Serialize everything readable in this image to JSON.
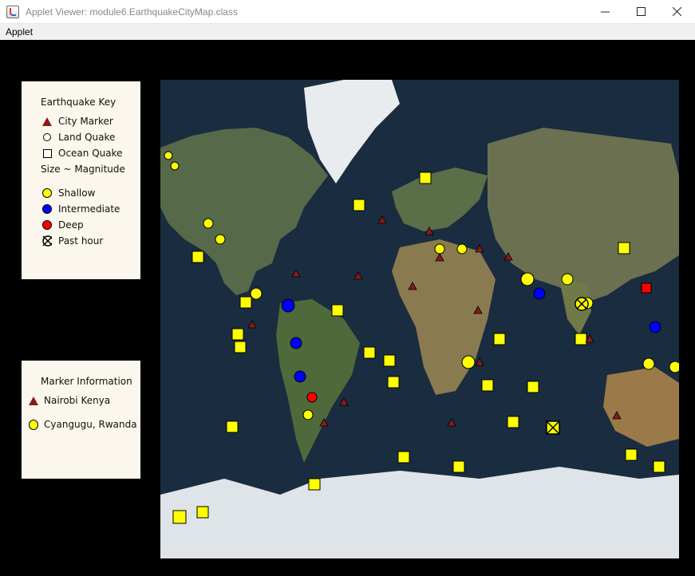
{
  "window": {
    "title": "Applet Viewer: module6.EarthquakeCityMap.class",
    "minimize_icon": "minimize-icon",
    "maximize_icon": "maximize-icon",
    "close_icon": "close-icon"
  },
  "menu": {
    "items": [
      "Applet"
    ]
  },
  "key": {
    "title": "Earthquake Key",
    "city_marker": "City Marker",
    "land_quake": "Land Quake",
    "ocean_quake": "Ocean Quake",
    "size_label": "Size ~ Magnitude",
    "shallow": "Shallow",
    "intermediate": "Intermediate",
    "deep": "Deep",
    "past_hour": "Past hour"
  },
  "info": {
    "title": "Marker Information",
    "city": "Nairobi Kenya",
    "quake": "Cyangugu, Rwanda"
  },
  "colors": {
    "shallow": "#ffff00",
    "intermediate": "#0000ff",
    "deep": "#ff0000",
    "city": "#8b1a1a",
    "panel": "#fbf7ec"
  }
}
